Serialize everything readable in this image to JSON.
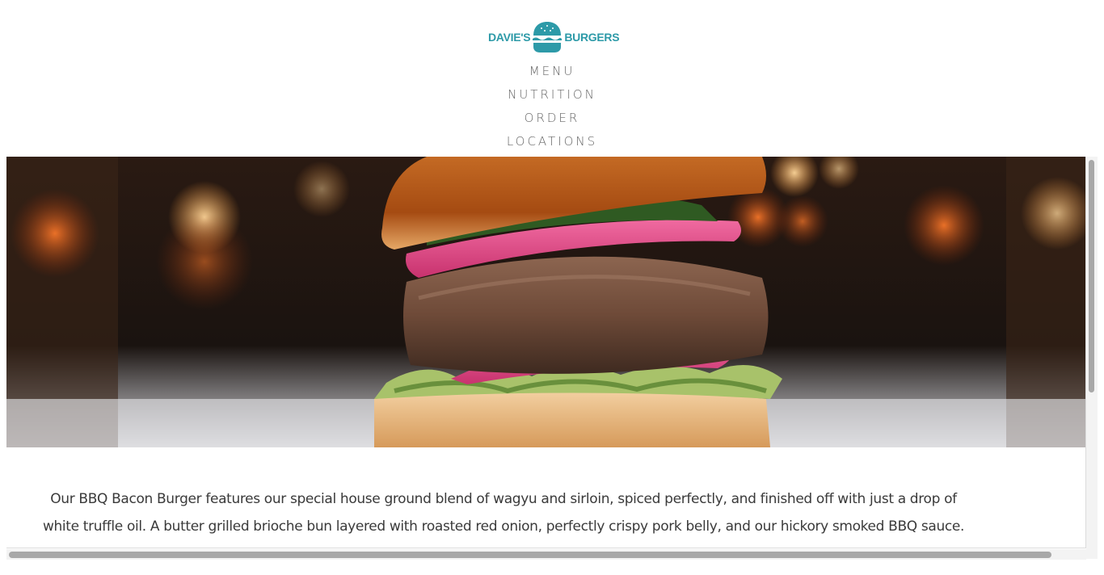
{
  "brand": {
    "name_left": "DAVIE'S",
    "name_right": "BURGERS",
    "color": "#2d9aa8"
  },
  "nav": {
    "items": [
      {
        "label": "MENU"
      },
      {
        "label": "NUTRITION"
      },
      {
        "label": "ORDER"
      },
      {
        "label": "LOCATIONS"
      }
    ]
  },
  "hero": {
    "image_description": "bbq-bacon-burger-photo"
  },
  "content": {
    "description_line1": "Our BBQ Bacon Burger features our special house ground blend of wagyu and sirloin, spiced perfectly, and finished off with just a drop of",
    "description_line2": "white truffle oil. A butter grilled brioche bun layered with roasted red onion, perfectly crispy pork belly, and our hickory smoked BBQ sauce."
  }
}
